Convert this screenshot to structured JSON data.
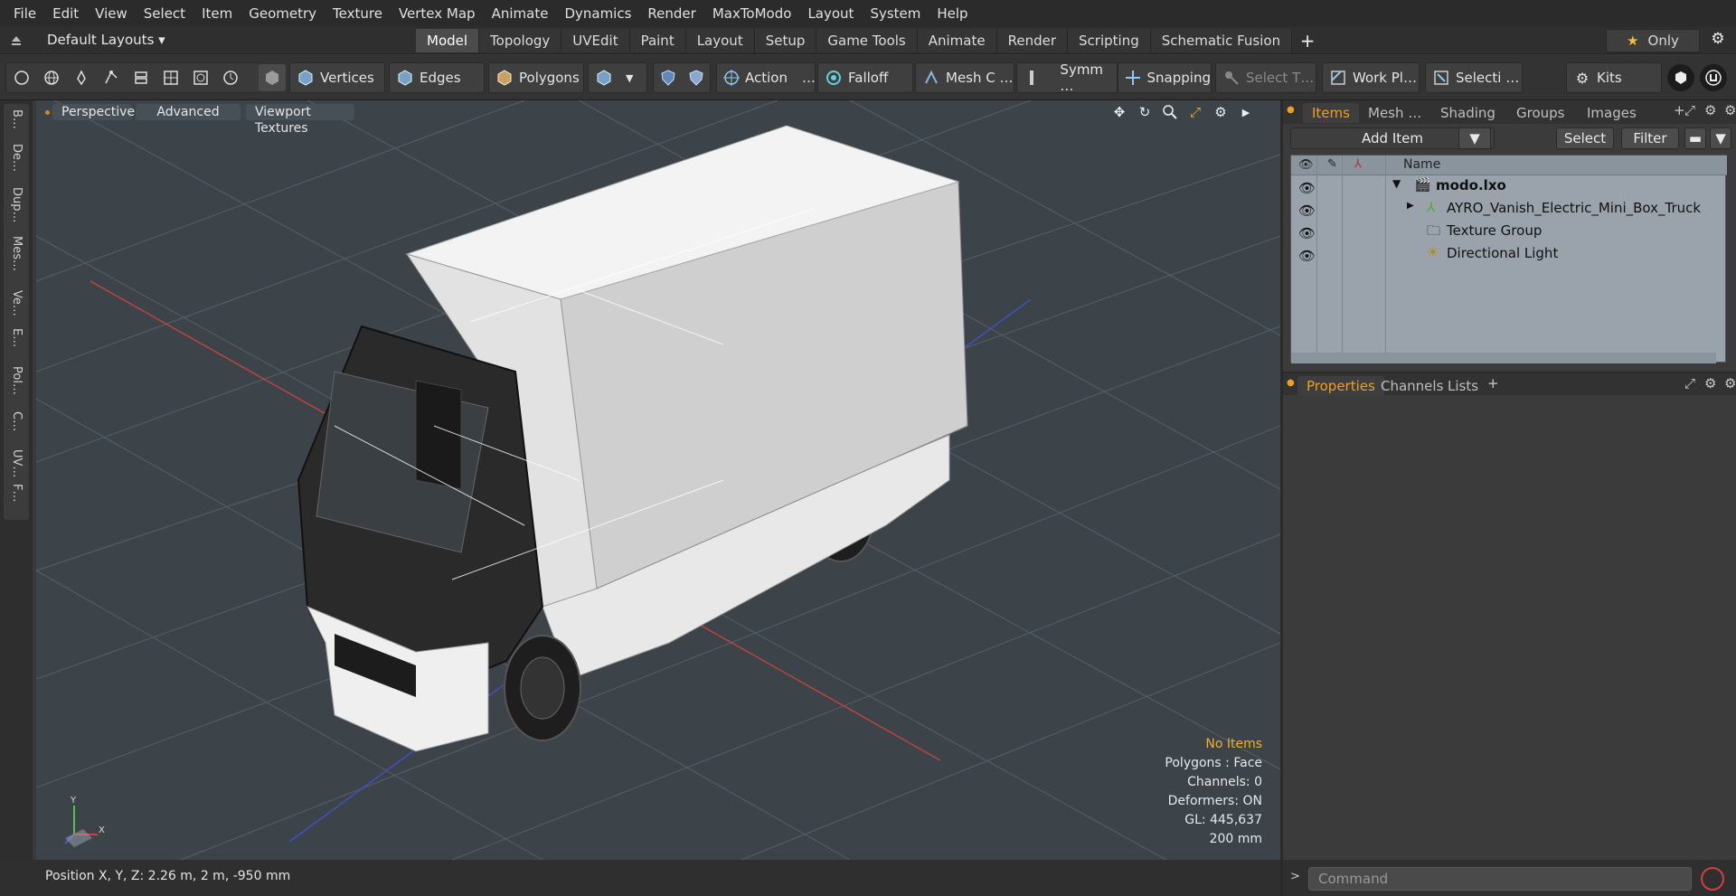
{
  "menu": [
    "File",
    "Edit",
    "View",
    "Select",
    "Item",
    "Geometry",
    "Texture",
    "Vertex Map",
    "Animate",
    "Dynamics",
    "Render",
    "MaxToModo",
    "Layout",
    "System",
    "Help"
  ],
  "layout_selector": "Default Layouts ▾",
  "tabs": [
    "Model",
    "Topology",
    "UVEdit",
    "Paint",
    "Layout",
    "Setup",
    "Game Tools",
    "Animate",
    "Render",
    "Scripting",
    "Schematic Fusion"
  ],
  "active_tab": "Model",
  "only_label": "Only",
  "toolbar": {
    "vertices": "Vertices",
    "edges": "Edges",
    "polygons": "Polygons",
    "action": "Action",
    "action_more": "…",
    "falloff": "Falloff",
    "mesh_c": "Mesh C …",
    "symm": "Symm …",
    "snapping": "Snapping",
    "select_t": "Select T…",
    "work_pl": "Work Pl…",
    "selecti": "Selecti …",
    "kits": "Kits"
  },
  "left_tabs": [
    "B…",
    "De…",
    "Dup…",
    "Mes…",
    "Ve…",
    "E…",
    "Pol…",
    "C…",
    "UV…",
    "F…"
  ],
  "viewport": {
    "perspective": "Perspective",
    "advanced": "Advanced",
    "viewport_textures": "Viewport Textures",
    "info": {
      "no_items": "No Items",
      "polygons": "Polygons : Face",
      "channels": "Channels: 0",
      "deformers": "Deformers: ON",
      "gl": "GL: 445,637",
      "scale": "200 mm"
    },
    "gizmo": {
      "x": "X",
      "y": "Y"
    }
  },
  "status": {
    "position": "Position X, Y, Z:   2.26 m, 2 m, -950 mm"
  },
  "items_panel": {
    "tabs": [
      "Items",
      "Mesh …",
      "Shading",
      "Groups",
      "Images"
    ],
    "add_item": "Add Item",
    "select": "Select",
    "filter": "Filter",
    "column_name": "Name",
    "rows": [
      {
        "name": "modo.lxo"
      },
      {
        "name": "AYRO_Vanish_Electric_Mini_Box_Truck"
      },
      {
        "name": "Texture Group"
      },
      {
        "name": "Directional Light"
      }
    ]
  },
  "properties_panel": {
    "tabs": [
      "Properties",
      "Channels",
      "Lists"
    ]
  },
  "command": {
    "placeholder": "Command"
  },
  "colors": {
    "accent": "#f0a020",
    "viewport_bg": "#3c444a",
    "list_bg": "#9aa3ab"
  }
}
